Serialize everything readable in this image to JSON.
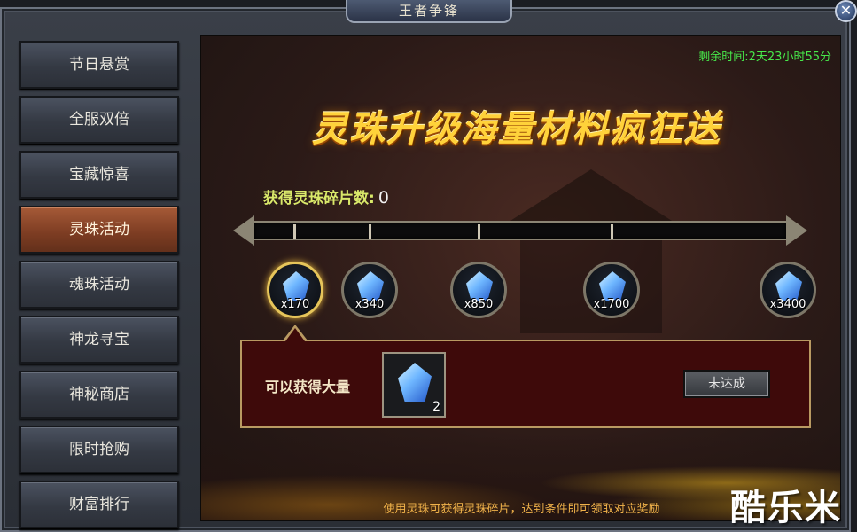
{
  "window": {
    "title": "王者争锋",
    "close_symbol": "✕"
  },
  "sidebar": {
    "items": [
      {
        "label": "节日悬赏",
        "active": false
      },
      {
        "label": "全服双倍",
        "active": false
      },
      {
        "label": "宝藏惊喜",
        "active": false
      },
      {
        "label": "灵珠活动",
        "active": true
      },
      {
        "label": "魂珠活动",
        "active": false
      },
      {
        "label": "神龙寻宝",
        "active": false
      },
      {
        "label": "神秘商店",
        "active": false
      },
      {
        "label": "限时抢购",
        "active": false
      },
      {
        "label": "财富排行",
        "active": false
      }
    ]
  },
  "main": {
    "remaining_time": "剩余时间:2天23小时55分",
    "banner": "灵珠升级海量材料疯狂送",
    "count_label": "获得灵珠碎片数:",
    "count_value": "0",
    "progress_fraction": 0,
    "milestones": [
      {
        "qty": "x170",
        "selected": true
      },
      {
        "qty": "x340",
        "selected": false
      },
      {
        "qty": "x850",
        "selected": false
      },
      {
        "qty": "x1700",
        "selected": false
      },
      {
        "qty": "x3400",
        "selected": false
      }
    ],
    "reward": {
      "label": "可以获得大量",
      "item_icon": "crystal-icon",
      "item_qty": "2",
      "status_button": "未达成"
    },
    "footer": "使用灵珠可获得灵珠碎片，达到条件即可领取对应奖励"
  },
  "watermark": "酷乐米",
  "colors": {
    "active_tab": "#7c3c22",
    "countdown": "#47e84a",
    "banner_gold": "#ffd23a",
    "footer_text": "#f0b24a"
  }
}
